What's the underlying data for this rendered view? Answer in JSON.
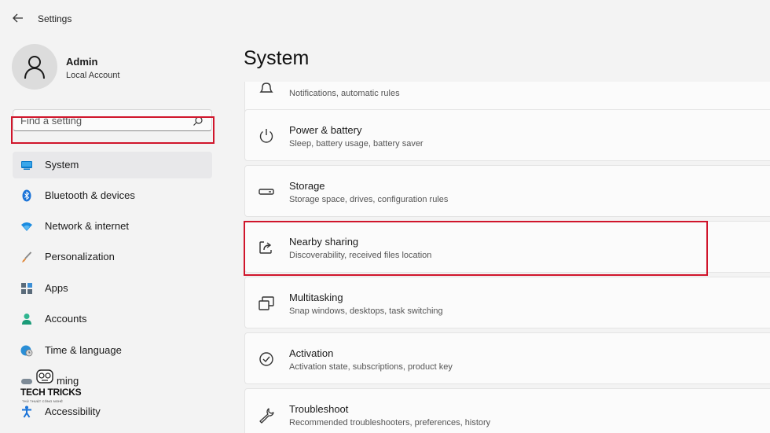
{
  "window": {
    "title": "Settings"
  },
  "user": {
    "name": "Admin",
    "account_type": "Local Account"
  },
  "search": {
    "placeholder": "Find a setting"
  },
  "sidebar": {
    "items": [
      {
        "label": "System",
        "icon": "system-display-icon",
        "selected": true
      },
      {
        "label": "Bluetooth & devices",
        "icon": "bluetooth-icon"
      },
      {
        "label": "Network & internet",
        "icon": "wifi-icon"
      },
      {
        "label": "Personalization",
        "icon": "paintbrush-icon"
      },
      {
        "label": "Apps",
        "icon": "apps-icon"
      },
      {
        "label": "Accounts",
        "icon": "person-icon"
      },
      {
        "label": "Time & language",
        "icon": "globe-clock-icon"
      },
      {
        "label": "Gaming",
        "icon": "gamepad-icon",
        "partially_obscured_text": "ming"
      },
      {
        "label": "Accessibility",
        "icon": "accessibility-icon"
      }
    ]
  },
  "watermark": {
    "text": "TECH TRICKS",
    "subtext": "THỦ THUẬT CÔNG NGHỆ"
  },
  "main": {
    "title": "System",
    "cards": [
      {
        "title": "",
        "subtitle": "Notifications, automatic rules",
        "icon": "bell-icon"
      },
      {
        "title": "Power & battery",
        "subtitle": "Sleep, battery usage, battery saver",
        "icon": "power-icon"
      },
      {
        "title": "Storage",
        "subtitle": "Storage space, drives, configuration rules",
        "icon": "storage-drive-icon"
      },
      {
        "title": "Nearby sharing",
        "subtitle": "Discoverability, received files location",
        "icon": "share-icon",
        "highlighted": true
      },
      {
        "title": "Multitasking",
        "subtitle": "Snap windows, desktops, task switching",
        "icon": "multitasking-icon"
      },
      {
        "title": "Activation",
        "subtitle": "Activation state, subscriptions, product key",
        "icon": "check-circle-icon"
      },
      {
        "title": "Troubleshoot",
        "subtitle": "Recommended troubleshooters, preferences, history",
        "icon": "wrench-icon"
      }
    ]
  },
  "colors": {
    "highlight_red": "#d0152b",
    "accent_blue": "#0078d4"
  }
}
